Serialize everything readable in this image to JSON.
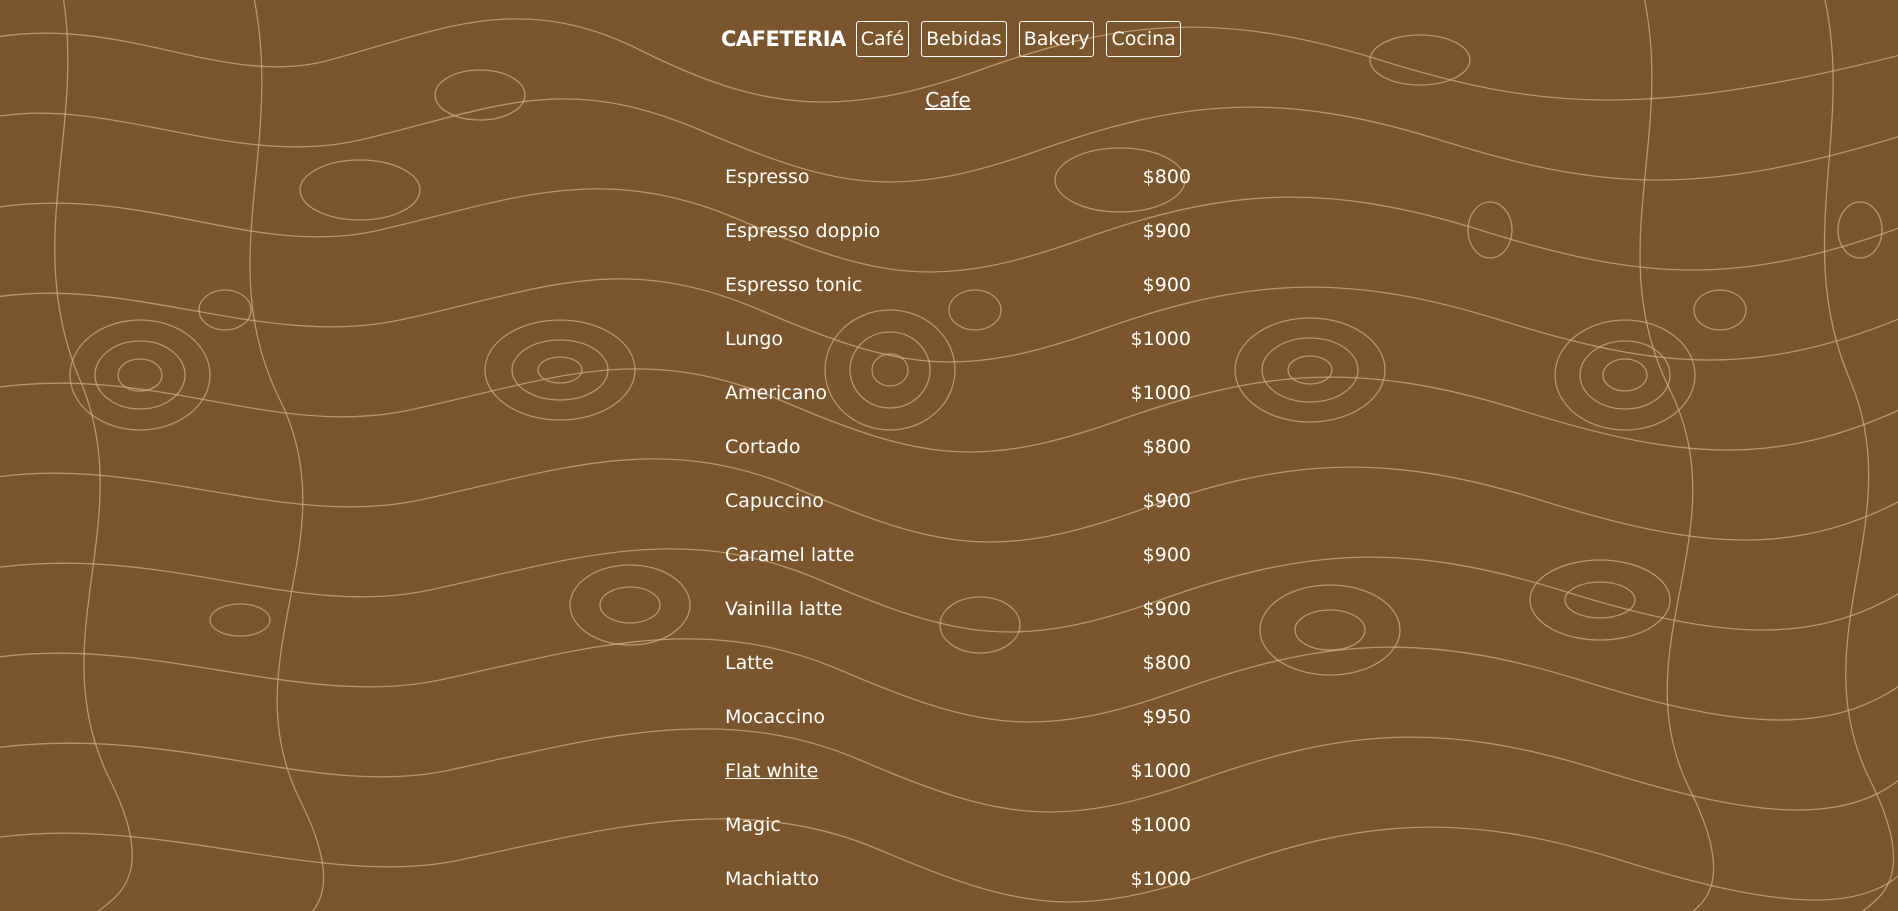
{
  "colors": {
    "background": "#7a552d",
    "contour": "#d2ad7f",
    "text": "#ffffff"
  },
  "header": {
    "brand": "CAFETERIA",
    "nav": [
      {
        "label": "Café"
      },
      {
        "label": "Bebidas"
      },
      {
        "label": "Bakery"
      },
      {
        "label": "Cocina"
      }
    ]
  },
  "section": {
    "title": "Cafe"
  },
  "menu": {
    "items": [
      {
        "name": "Espresso",
        "price": "$800"
      },
      {
        "name": "Espresso doppio",
        "price": "$900"
      },
      {
        "name": "Espresso tonic",
        "price": "$900"
      },
      {
        "name": "Lungo",
        "price": "$1000"
      },
      {
        "name": "Americano",
        "price": "$1000"
      },
      {
        "name": "Cortado",
        "price": "$800"
      },
      {
        "name": "Capuccino",
        "price": "$900"
      },
      {
        "name": "Caramel latte",
        "price": "$900"
      },
      {
        "name": "Vainilla latte",
        "price": "$900"
      },
      {
        "name": "Latte",
        "price": "$800"
      },
      {
        "name": "Mocaccino",
        "price": "$950"
      },
      {
        "name": "Flat white",
        "price": "$1000"
      },
      {
        "name": "Magic",
        "price": "$1000"
      },
      {
        "name": "Machiatto",
        "price": "$1000"
      }
    ]
  }
}
